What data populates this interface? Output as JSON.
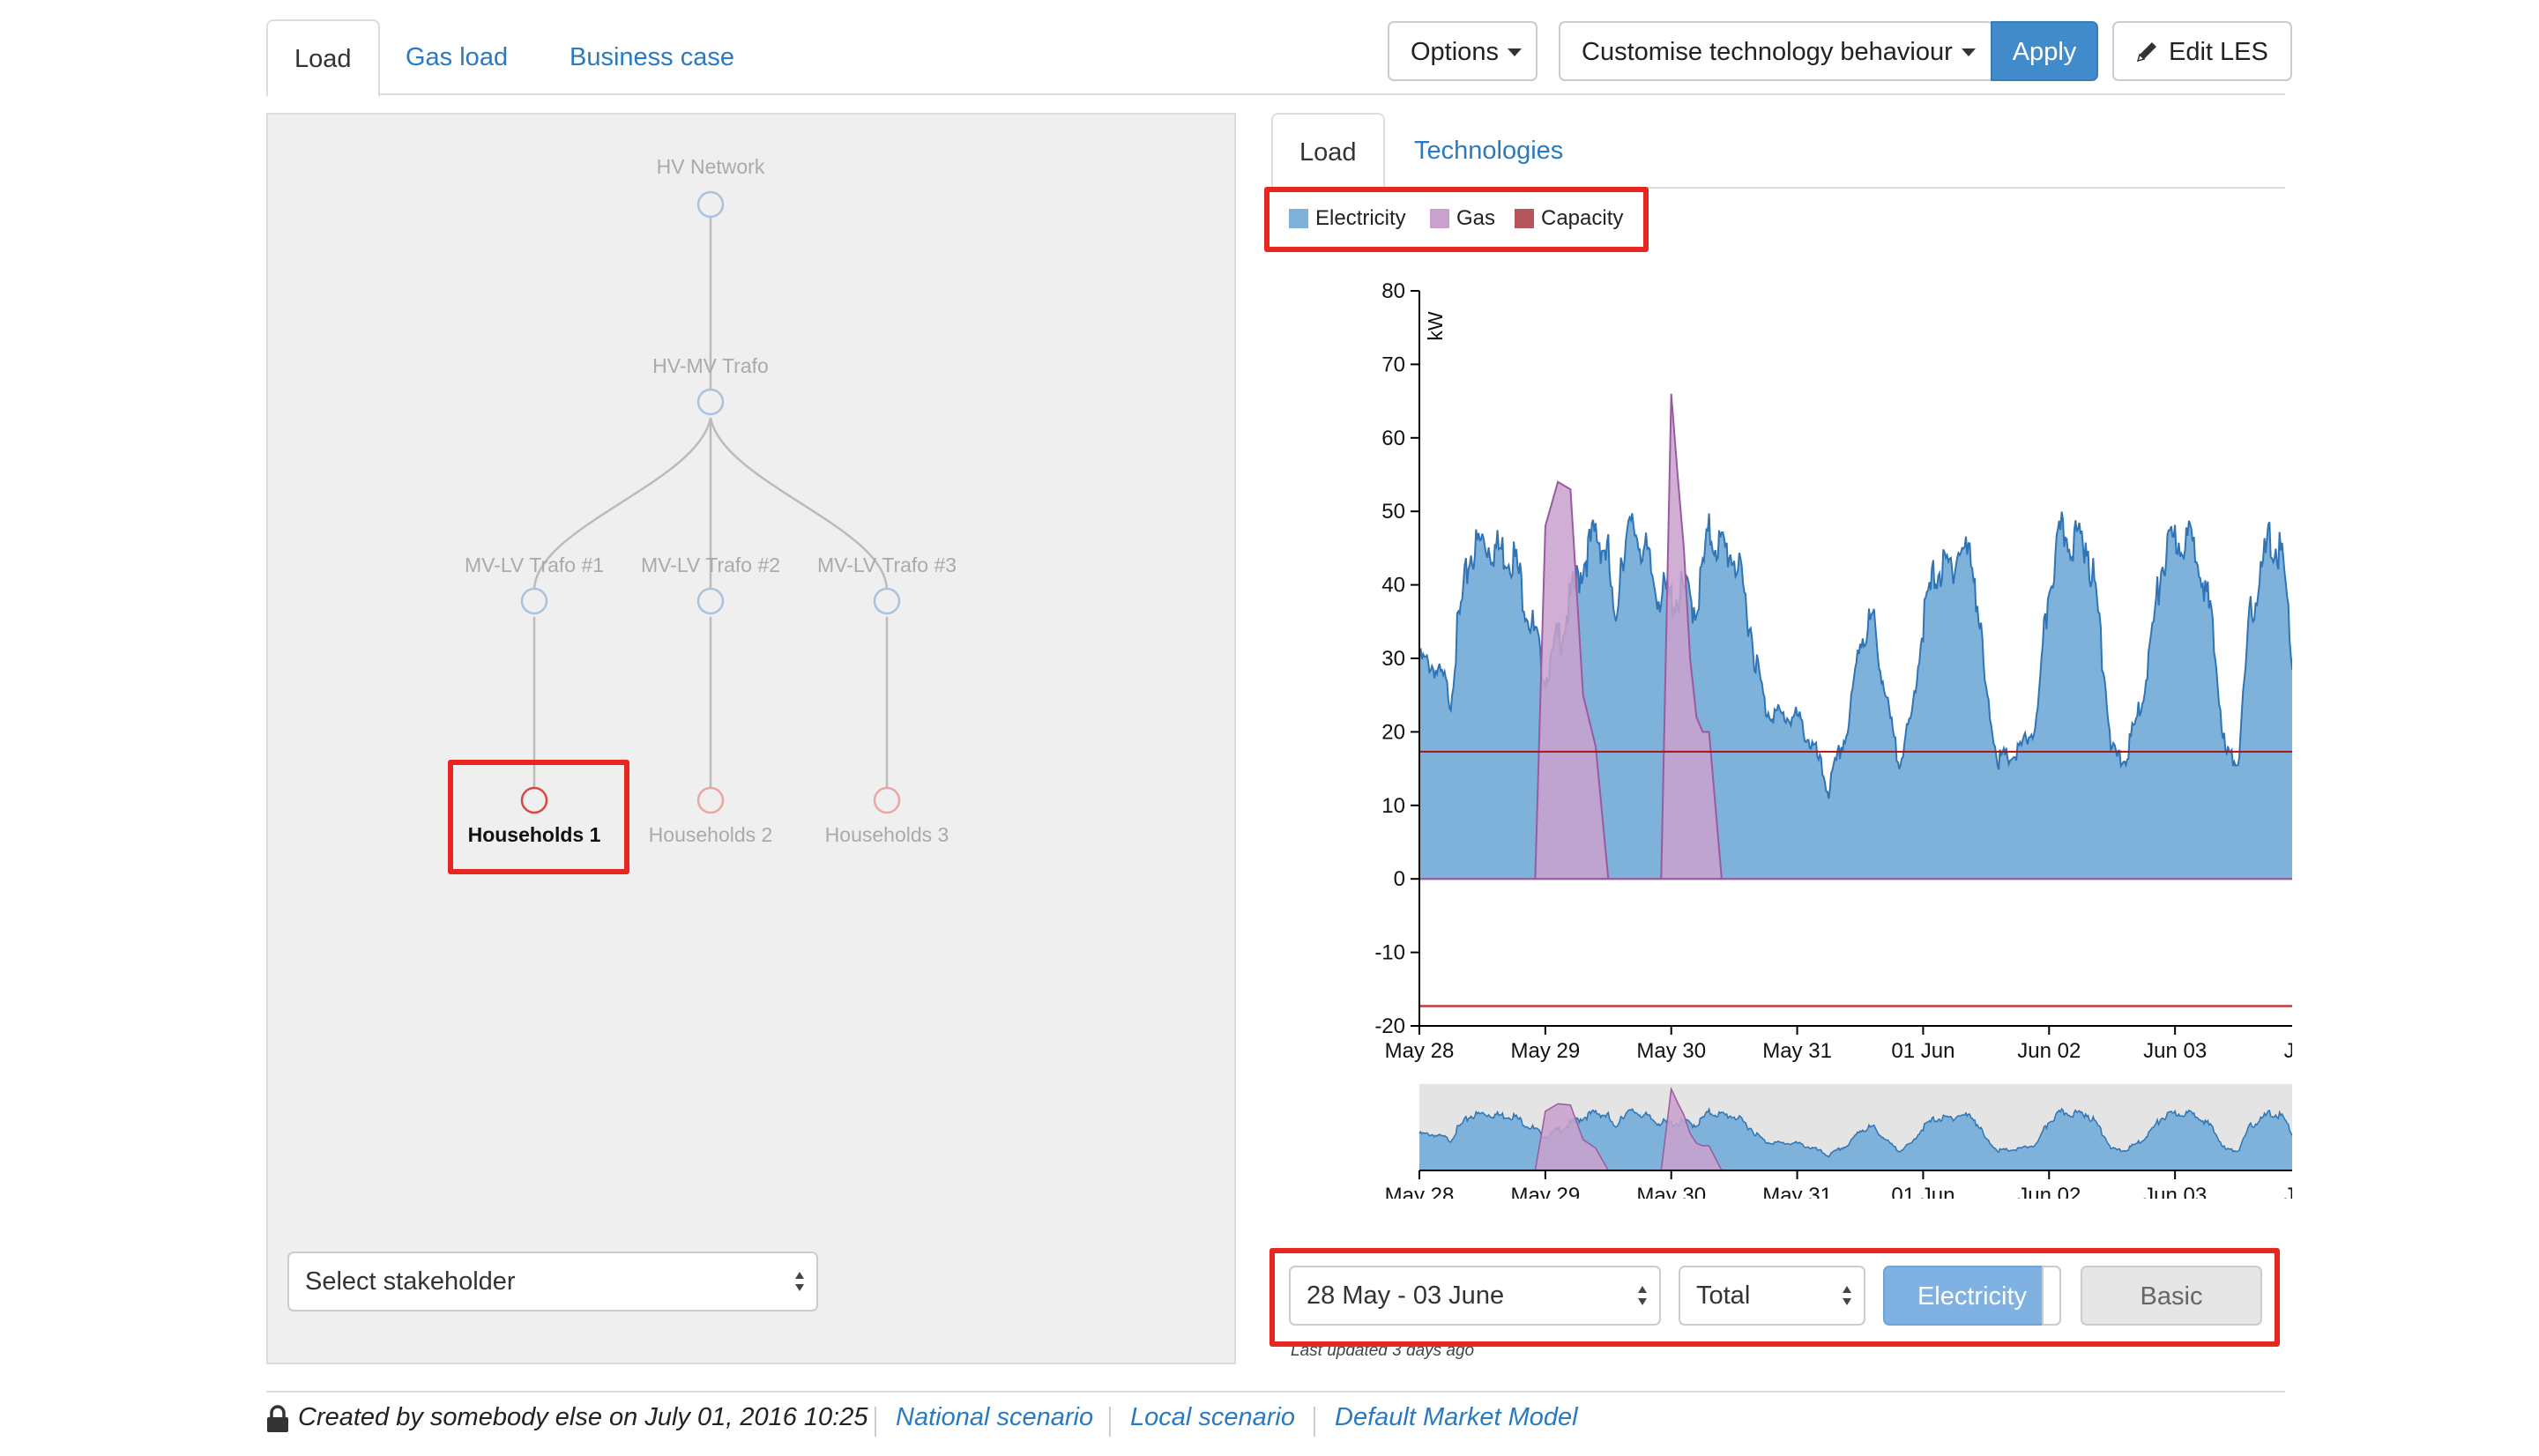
{
  "main_tabs": [
    {
      "label": "Load",
      "active": true
    },
    {
      "label": "Gas load",
      "active": false
    },
    {
      "label": "Business case",
      "active": false
    }
  ],
  "toolbar": {
    "options_label": "Options",
    "customise_label": "Customise technology behaviour",
    "apply_label": "Apply",
    "edit_label": "Edit LES"
  },
  "tree": {
    "hv_network": "HV Network",
    "hv_mv_trafo": "HV-MV Trafo",
    "mv_lv_1": "MV-LV Trafo #1",
    "mv_lv_2": "MV-LV Trafo #2",
    "mv_lv_3": "MV-LV Trafo #3",
    "households_1": "Households 1",
    "households_2": "Households 2",
    "households_3": "Households 3",
    "selected": "Households 1"
  },
  "stakeholder_select": {
    "value": "Select stakeholder"
  },
  "chart_tabs": [
    {
      "label": "Load",
      "active": true
    },
    {
      "label": "Technologies",
      "active": false
    }
  ],
  "legend": [
    {
      "label": "Electricity",
      "color": "#7fb2da"
    },
    {
      "label": "Gas",
      "color": "#c9a1cc"
    },
    {
      "label": "Capacity",
      "color": "#b3555a"
    }
  ],
  "colors": {
    "electricity_fill": "#7fb2da",
    "electricity_line": "#2f74b5",
    "gas_fill": "#c9a1cc",
    "gas_line": "#9a5aa0",
    "overlap_fill": "#8e78ac",
    "capacity": "#a4161a",
    "capacity_line": "#c43a3a",
    "highlight": "#e8251f",
    "link": "#2a7ac2",
    "primary": "#428bca"
  },
  "chart_data": {
    "type": "area",
    "ylabel": "kW",
    "ylim": [
      -20,
      80
    ],
    "yticks": [
      80,
      70,
      60,
      50,
      40,
      30,
      20,
      10,
      0,
      -10,
      -20
    ],
    "x_tick_labels": [
      "May 28",
      "May 29",
      "May 30",
      "May 31",
      "01 Jun",
      "Jun 02",
      "Jun 03",
      "Jun"
    ],
    "x_days": [
      0,
      1,
      2,
      3,
      4,
      5,
      6,
      7
    ],
    "series": [
      {
        "name": "Electricity",
        "x": [
          0,
          0.1,
          0.2,
          0.25,
          0.3,
          0.4,
          0.5,
          0.6,
          0.75,
          0.9,
          1.0,
          1.15,
          1.3,
          1.4,
          1.5,
          1.55,
          1.6,
          1.65,
          1.7,
          1.8,
          1.85,
          1.9,
          2.0,
          2.1,
          2.2,
          2.25,
          2.3,
          2.4,
          2.5,
          2.6,
          2.75,
          2.9,
          3.0,
          3.15,
          3.25,
          3.35,
          3.4,
          3.5,
          3.6,
          3.7,
          3.8,
          3.9,
          4.0,
          4.1,
          4.2,
          4.3,
          4.4,
          4.5,
          4.6,
          4.75,
          4.9,
          5.0,
          5.1,
          5.2,
          5.3,
          5.4,
          5.5,
          5.6,
          5.75,
          5.9,
          6.0,
          6.1,
          6.2,
          6.3,
          6.4,
          6.5,
          6.6,
          6.75,
          6.85,
          7.0
        ],
        "values": [
          30,
          29,
          27,
          24,
          33,
          44,
          46,
          45,
          44,
          34,
          27,
          35,
          43,
          47,
          44,
          33,
          44,
          46,
          48,
          44,
          41,
          39,
          38,
          39,
          37,
          42,
          47,
          45,
          44,
          37,
          23,
          22,
          22,
          17,
          12,
          18,
          20,
          33,
          35,
          25,
          16,
          21,
          35,
          42,
          42,
          45,
          43,
          25,
          16,
          17,
          21,
          40,
          47,
          46,
          46,
          35,
          17,
          16,
          25,
          43,
          46,
          46,
          44,
          33,
          17,
          16,
          36,
          46,
          44,
          19
        ]
      },
      {
        "name": "Gas",
        "x": [
          0,
          0.9,
          0.92,
          1.0,
          1.1,
          1.2,
          1.3,
          1.4,
          1.5,
          1.55,
          1.9,
          1.92,
          2.0,
          2.05,
          2.1,
          2.15,
          2.2,
          2.25,
          2.3,
          2.4,
          7.0
        ],
        "values": [
          0,
          0,
          0,
          48,
          54,
          53,
          25,
          18,
          0,
          0,
          0,
          0,
          66,
          55,
          45,
          30,
          22,
          20,
          20,
          0,
          0
        ]
      },
      {
        "name": "Capacity",
        "x": [
          0,
          7
        ],
        "values": [
          17.3,
          17.3
        ]
      },
      {
        "name": "Capacity",
        "x": [
          0,
          7
        ],
        "values": [
          -17.3,
          -17.3
        ]
      }
    ]
  },
  "controls": {
    "date_range": "28 May - 03 June",
    "aggregation": "Total",
    "carrier_toggle": "Electricity",
    "view_toggle": "Basic",
    "last_updated": "Last updated 3 days ago"
  },
  "footer": {
    "created": "Created by somebody else on July 01, 2016 10:25",
    "national": "National scenario",
    "local": "Local scenario",
    "market": "Default Market Model"
  }
}
